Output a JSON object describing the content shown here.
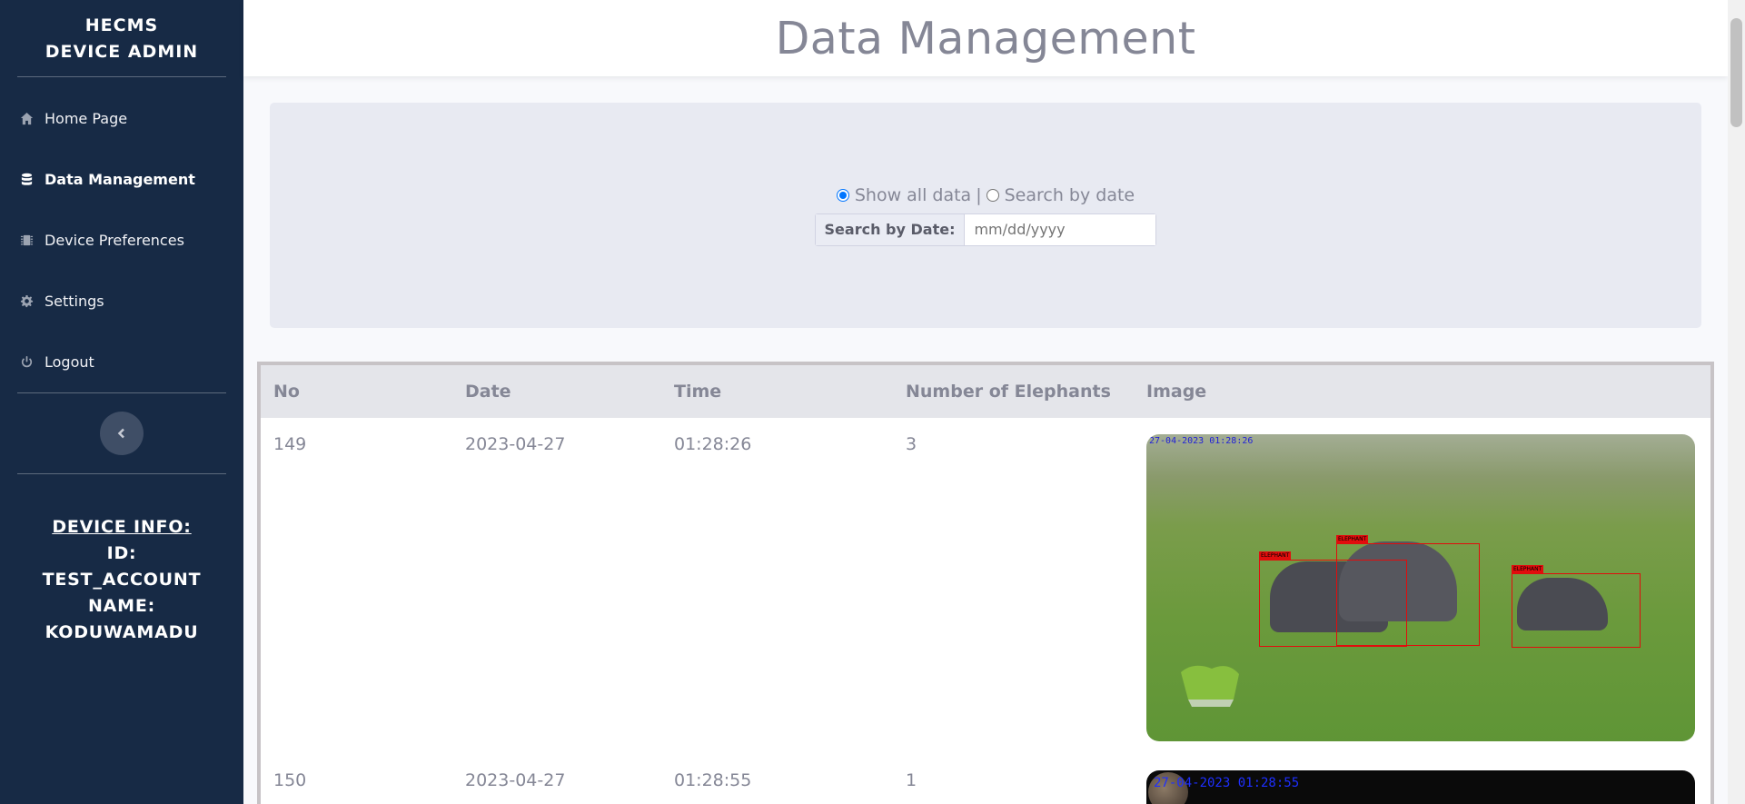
{
  "sidebar": {
    "brand_line1": "HECMS",
    "brand_line2": "DEVICE ADMIN",
    "items": [
      {
        "label": "Home Page",
        "icon": "home-icon"
      },
      {
        "label": "Data Management",
        "icon": "database-icon",
        "active": true
      },
      {
        "label": "Device Preferences",
        "icon": "microchip-icon"
      },
      {
        "label": "Settings",
        "icon": "gear-icon"
      },
      {
        "label": "Logout",
        "icon": "power-icon"
      }
    ],
    "device_info": {
      "heading": "DEVICE INFO:",
      "id_label": "ID:",
      "id_value": "TEST_ACCOUNT",
      "name_label": "NAME:",
      "name_value": "KODUWAMADU"
    }
  },
  "header": {
    "title": "Data Management"
  },
  "filter": {
    "option_all": "Show all data",
    "separator": "|",
    "option_date": "Search by date",
    "date_label": "Search by Date:",
    "date_placeholder": "mm/dd/yyyy"
  },
  "table": {
    "columns": [
      "No",
      "Date",
      "Time",
      "Number of Elephants",
      "Image"
    ],
    "rows": [
      {
        "no": "149",
        "date": "2023-04-27",
        "time": "01:28:26",
        "count": "3",
        "image_stamp": "27-04-2023 01:28:26"
      },
      {
        "no": "150",
        "date": "2023-04-27",
        "time": "01:28:55",
        "count": "1",
        "image_stamp": "27-04-2023 01:28:55"
      }
    ],
    "detection_label": "ELEPHANT"
  },
  "colors": {
    "sidebar_bg": "#172a45",
    "accent_radio": "#0075ff",
    "detection_box": "#e10d0d"
  }
}
